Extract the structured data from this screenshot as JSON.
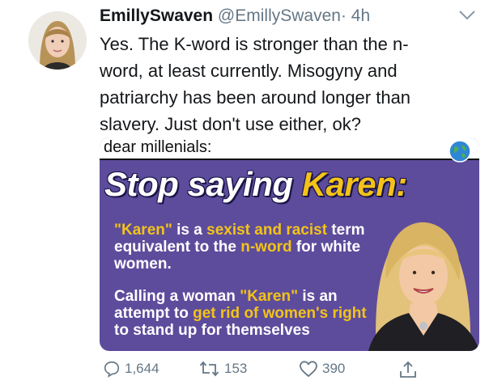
{
  "tweet": {
    "display_name": "EmillySwaven",
    "handle": "@EmillySwaven",
    "separator": "·",
    "time": "4h",
    "lines": [
      "Yes. The K-word is stronger than the n-",
      "word, at least currently. Misogyny and",
      "patriarchy has been around longer than",
      "slavery. Just don't use either, ok?"
    ]
  },
  "media": {
    "top_caption": "dear millenials:",
    "headline_white": "Stop saying ",
    "headline_yellow": "Karen",
    "headline_tail": ":",
    "para1": {
      "a": "\"Karen\"",
      "b": " is a ",
      "c": "sexist and racist",
      "d": " term equivalent to the ",
      "e": "n-word",
      "f": " for white women."
    },
    "para2": {
      "a": "Calling a woman ",
      "b": "\"Karen\"",
      "c": " is an attempt to ",
      "d": "get rid of women's right",
      "e": " to stand up for themselves"
    },
    "colors": {
      "background": "#5d4c9c",
      "highlight": "#f3c319"
    }
  },
  "actions": {
    "reply_count": "1,644",
    "retweet_count": "153",
    "like_count": "390"
  },
  "icons": {
    "reply": "reply-icon",
    "retweet": "retweet-icon",
    "like": "heart-icon",
    "share": "share-icon",
    "menu": "chevron-down-icon",
    "globe": "globe-icon"
  }
}
